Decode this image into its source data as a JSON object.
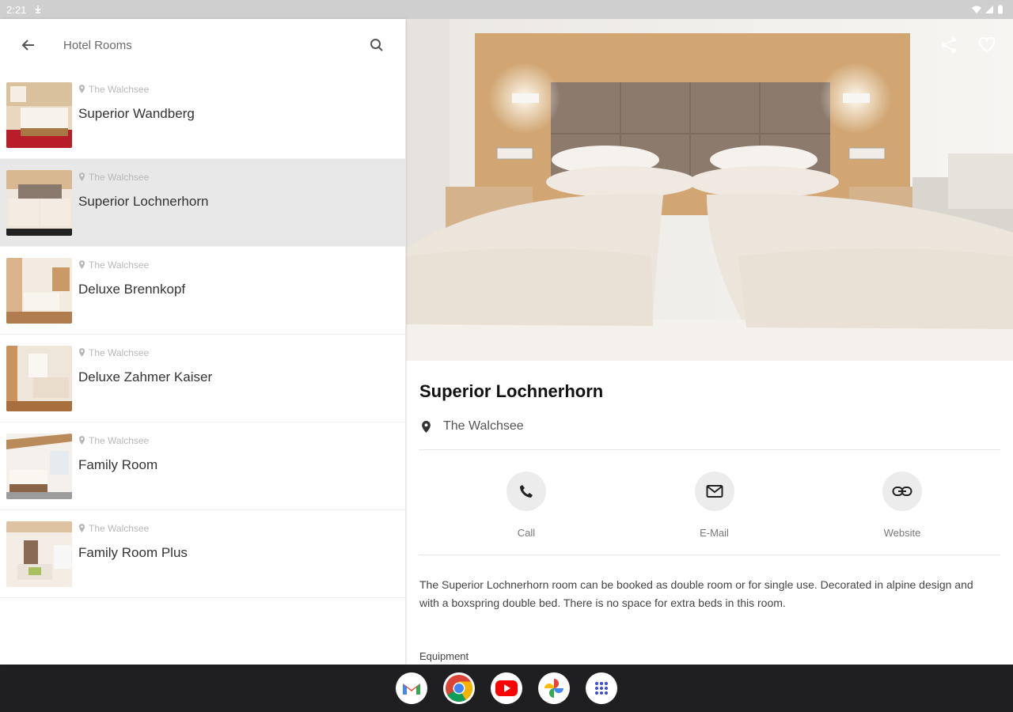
{
  "status_bar": {
    "time": "2:21"
  },
  "left_pane": {
    "title": "Hotel Rooms",
    "rooms": [
      {
        "location": "The Walchsee",
        "name": "Superior Wandberg"
      },
      {
        "location": "The Walchsee",
        "name": "Superior Lochnerhorn"
      },
      {
        "location": "The Walchsee",
        "name": "Deluxe Brennkopf"
      },
      {
        "location": "The Walchsee",
        "name": "Deluxe Zahmer Kaiser"
      },
      {
        "location": "The Walchsee",
        "name": "Family Room"
      },
      {
        "location": "The Walchsee",
        "name": "Family Room Plus"
      }
    ],
    "selected_index": 1
  },
  "detail": {
    "title": "Superior Lochnerhorn",
    "location": "The Walchsee",
    "actions": {
      "call": "Call",
      "email": "E-Mail",
      "website": "Website"
    },
    "description": "The Superior Lochnerhorn room can be booked as double room or for single use. Decorated in alpine design and with a boxspring double bed. There is no space for extra beds in this room.",
    "equipment_heading": "Equipment"
  },
  "icons": [
    "back-arrow-icon",
    "search-icon",
    "location-pin-icon",
    "share-icon",
    "heart-icon",
    "phone-icon",
    "mail-icon",
    "link-icon",
    "gmail-icon",
    "chrome-icon",
    "youtube-icon",
    "photos-icon",
    "app-drawer-icon"
  ],
  "colors": {
    "selected_row": "#e8e8e8",
    "nav_bar": "#1f1f21",
    "status_bar": "#cfcfcf"
  }
}
